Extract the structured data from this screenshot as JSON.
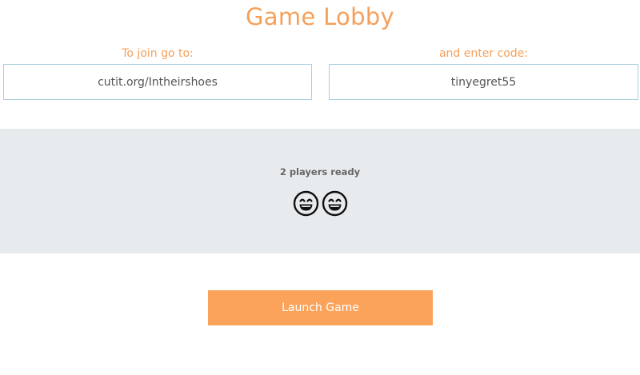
{
  "title": "Game Lobby",
  "join": {
    "url_label": "To join go to:",
    "url_value": "cutit.org/Intheirshoes",
    "code_label": "and enter code:",
    "code_value": "tinyegret55"
  },
  "lobby": {
    "status": "2 players ready",
    "players": [
      {
        "icon": "grinning-face-icon"
      },
      {
        "icon": "grinning-face-icon"
      }
    ]
  },
  "actions": {
    "launch_label": "Launch Game"
  },
  "colors": {
    "accent": "#f5a05a",
    "button": "#fca35b",
    "panel": "#e8ebee",
    "box_border": "#a9cfe0"
  }
}
